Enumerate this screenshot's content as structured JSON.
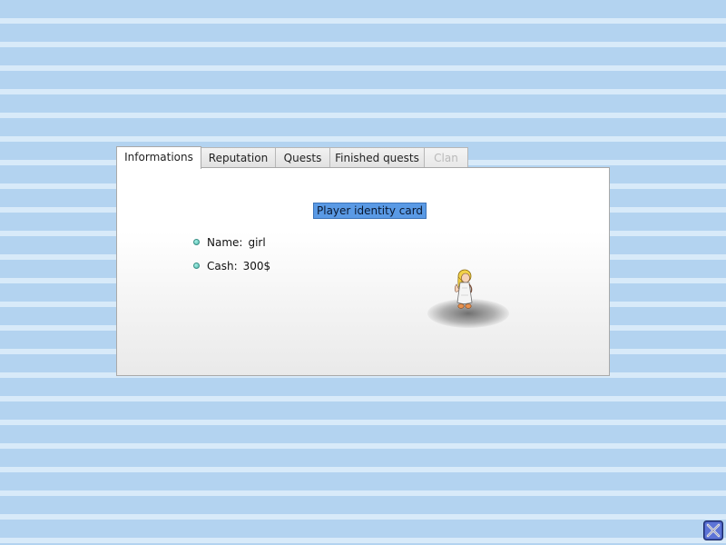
{
  "tabs": [
    {
      "label": "Informations",
      "state": "active"
    },
    {
      "label": "Reputation",
      "state": "normal"
    },
    {
      "label": "Quests",
      "state": "normal"
    },
    {
      "label": "Finished quests",
      "state": "normal"
    },
    {
      "label": "Clan",
      "state": "disabled"
    }
  ],
  "card": {
    "title": "Player identity card",
    "name_label": "Name:",
    "name_value": "girl",
    "cash_label": "Cash:",
    "cash_value": "300$"
  },
  "player": {
    "avatar_icon": "player-sprite-icon"
  },
  "corner": {
    "icon": "close-crossed-swords-icon"
  },
  "colors": {
    "title_highlight": "#5a9ae5",
    "bullet": "#4fb9ad",
    "stripe_dark": "#b3d3f0",
    "stripe_light": "#d8eaf9"
  }
}
